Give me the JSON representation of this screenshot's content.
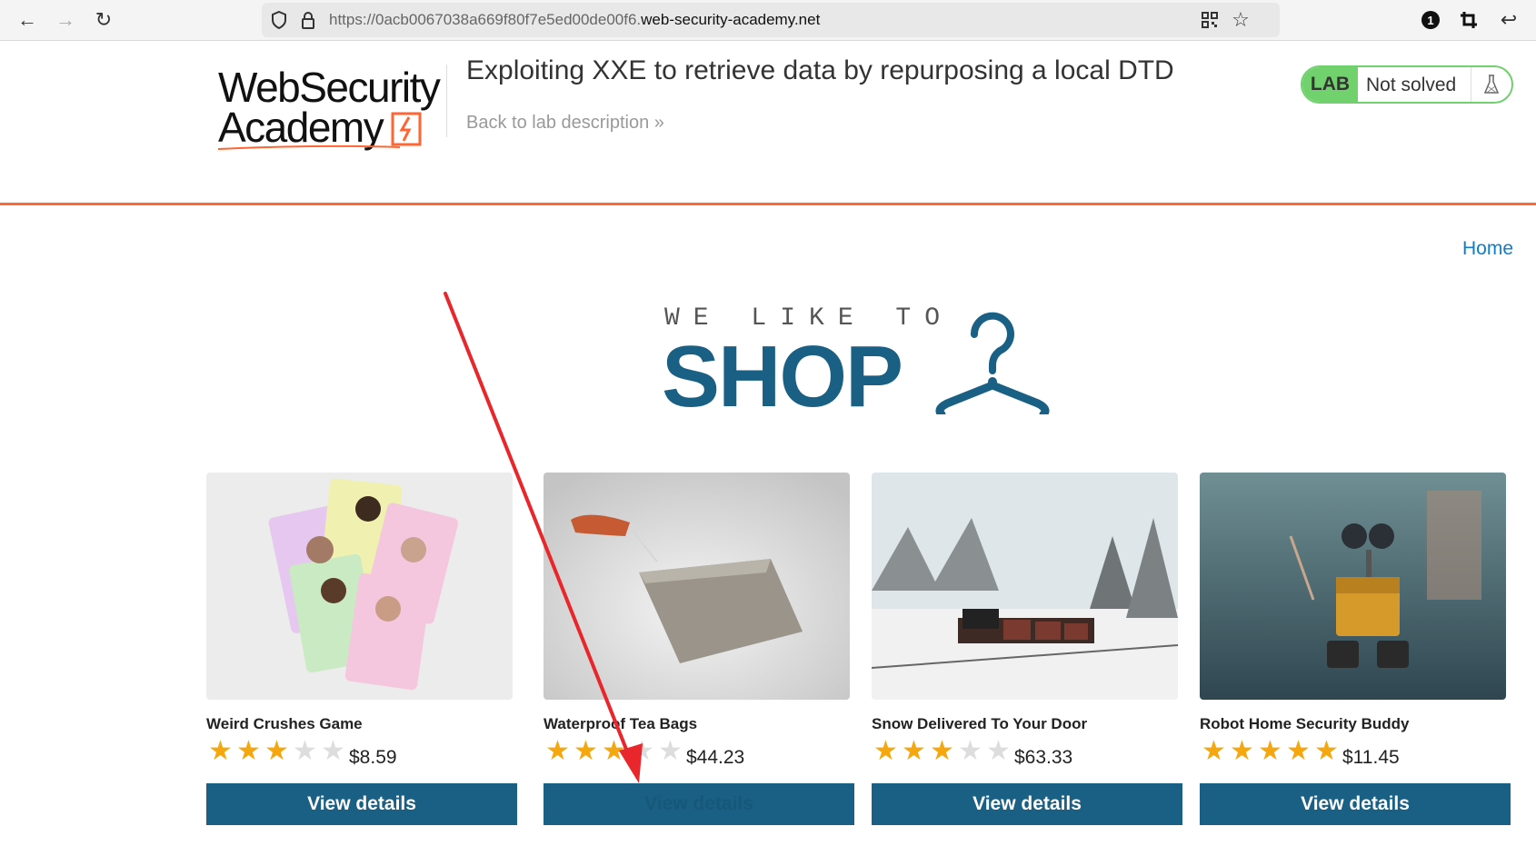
{
  "browser": {
    "url_prefix": "https://0acb0067038a669f80f7e5ed00de00f6.",
    "url_domain": "web-security-academy.net",
    "notification_count": "1"
  },
  "header": {
    "logo_line1": "WebSecurity",
    "logo_line2": "Academy",
    "lab_title": "Exploiting XXE to retrieve data by repurposing a local DTD",
    "back_link": "Back to lab description »",
    "lab_badge": "LAB",
    "lab_status": "Not solved"
  },
  "nav": {
    "home": "Home"
  },
  "banner": {
    "small": "WE LIKE TO",
    "big": "SHOP"
  },
  "products": [
    {
      "name": "Weird Crushes Game",
      "price": "$8.59",
      "stars": 3,
      "button": "View details"
    },
    {
      "name": "Waterproof Tea Bags",
      "price": "$44.23",
      "stars": 3,
      "button": "View details"
    },
    {
      "name": "Snow Delivered To Your Door",
      "price": "$63.33",
      "stars": 3,
      "button": "View details"
    },
    {
      "name": "Robot Home Security Buddy",
      "price": "$11.45",
      "stars": 5,
      "button": "View details"
    }
  ],
  "colors": {
    "accent": "#1a6084",
    "header_rule": "#ff6633",
    "lab_green": "#70d16d",
    "star": "#f4a70f",
    "arrow": "#e8262b"
  }
}
